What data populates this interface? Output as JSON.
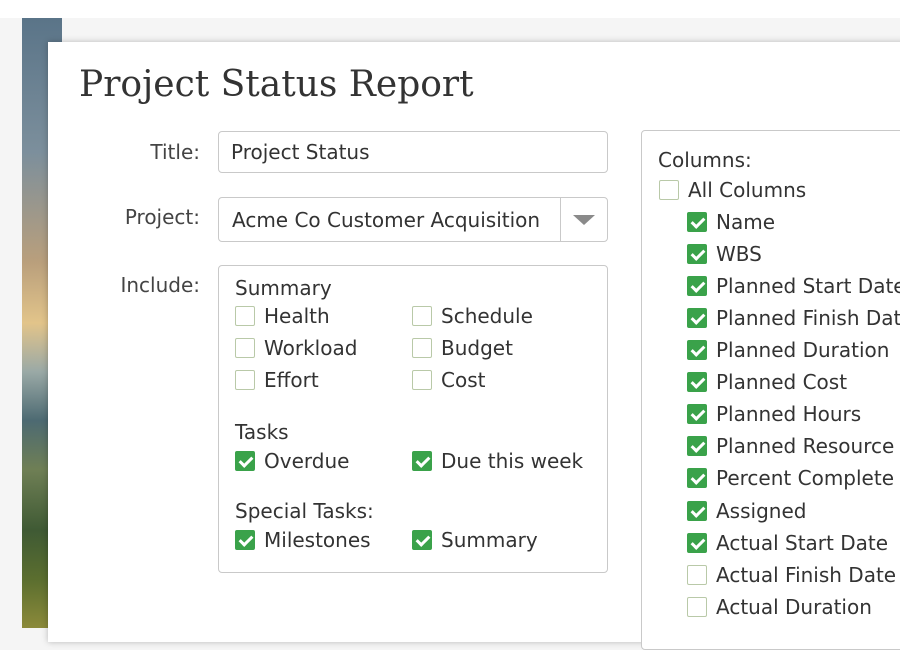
{
  "report": {
    "title": "Project Status Report"
  },
  "form": {
    "title_label": "Title:",
    "title_value": "Project Status",
    "project_label": "Project:",
    "project_value": "Acme Co Customer Acquisition",
    "include_label": "Include:"
  },
  "include": {
    "summary_heading": "Summary",
    "summary_items": [
      {
        "label": "Health",
        "checked": false
      },
      {
        "label": "Schedule",
        "checked": false
      },
      {
        "label": "Workload",
        "checked": false
      },
      {
        "label": "Budget",
        "checked": false
      },
      {
        "label": "Effort",
        "checked": false
      },
      {
        "label": "Cost",
        "checked": false
      }
    ],
    "tasks_heading": "Tasks",
    "tasks_items": [
      {
        "label": "Overdue",
        "checked": true
      },
      {
        "label": "Due this week",
        "checked": true
      }
    ],
    "special_heading": "Special Tasks:",
    "special_items": [
      {
        "label": "Milestones",
        "checked": true
      },
      {
        "label": "Summary",
        "checked": true
      }
    ]
  },
  "columns": {
    "heading": "Columns:",
    "all": {
      "label": "All Columns",
      "checked": false
    },
    "items": [
      {
        "label": "Name",
        "checked": true
      },
      {
        "label": "WBS",
        "checked": true
      },
      {
        "label": "Planned Start Date",
        "checked": true
      },
      {
        "label": "Planned Finish Date",
        "checked": true
      },
      {
        "label": "Planned Duration",
        "checked": true
      },
      {
        "label": "Planned Cost",
        "checked": true
      },
      {
        "label": "Planned Hours",
        "checked": true
      },
      {
        "label": "Planned Resource",
        "checked": true
      },
      {
        "label": "Percent Complete",
        "checked": true
      },
      {
        "label": "Assigned",
        "checked": true
      },
      {
        "label": "Actual Start Date",
        "checked": true
      },
      {
        "label": "Actual Finish Date",
        "checked": false
      },
      {
        "label": "Actual Duration",
        "checked": false
      }
    ]
  },
  "colors": {
    "check_green": "#3aa24a",
    "border_gray": "#c9c9c9",
    "text_dark": "#333333"
  }
}
